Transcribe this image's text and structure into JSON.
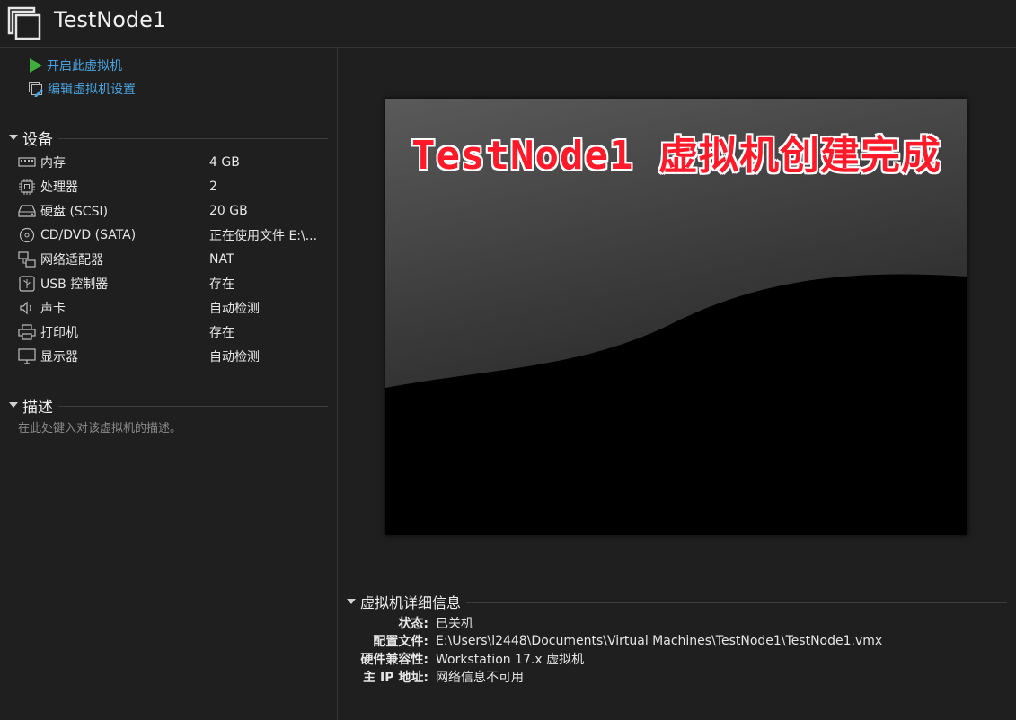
{
  "window": {
    "title": "TestNode1",
    "icon": "vm-window-icon"
  },
  "actions": [
    {
      "label": "开启此虚拟机",
      "icon": "play-icon"
    },
    {
      "label": "编辑虚拟机设置",
      "icon": "edit-settings-icon"
    }
  ],
  "devices": {
    "heading": "设备",
    "items": [
      {
        "name": "内存",
        "value": "4 GB",
        "icon": "memory-icon"
      },
      {
        "name": "处理器",
        "value": "2",
        "icon": "cpu-icon"
      },
      {
        "name": "硬盘 (SCSI)",
        "value": "20 GB",
        "icon": "hard-disk-icon"
      },
      {
        "name": "CD/DVD (SATA)",
        "value": "正在使用文件 E:\\...",
        "icon": "cd-dvd-icon"
      },
      {
        "name": "网络适配器",
        "value": "NAT",
        "icon": "network-icon"
      },
      {
        "name": "USB 控制器",
        "value": "存在",
        "icon": "usb-icon"
      },
      {
        "name": "声卡",
        "value": "自动检测",
        "icon": "speaker-icon"
      },
      {
        "name": "打印机",
        "value": "存在",
        "icon": "printer-icon"
      },
      {
        "name": "显示器",
        "value": "自动检测",
        "icon": "monitor-icon"
      }
    ]
  },
  "description": {
    "heading": "描述",
    "placeholder": "在此处键入对该虚拟机的描述。"
  },
  "preview": {
    "caption": "TestNode1 虚拟机创建完成"
  },
  "details": {
    "heading": "虚拟机详细信息",
    "rows": [
      {
        "key": "状态:",
        "value": "已关机"
      },
      {
        "key": "配置文件:",
        "value": "E:\\Users\\l2448\\Documents\\Virtual Machines\\TestNode1\\TestNode1.vmx"
      },
      {
        "key": "硬件兼容性:",
        "value": "Workstation 17.x 虚拟机"
      },
      {
        "key": "主 IP 地址:",
        "value": "网络信息不可用"
      }
    ]
  },
  "colors": {
    "link": "#4aa3e0",
    "play": "#3fae3a",
    "caption": "#ff1a2a"
  }
}
